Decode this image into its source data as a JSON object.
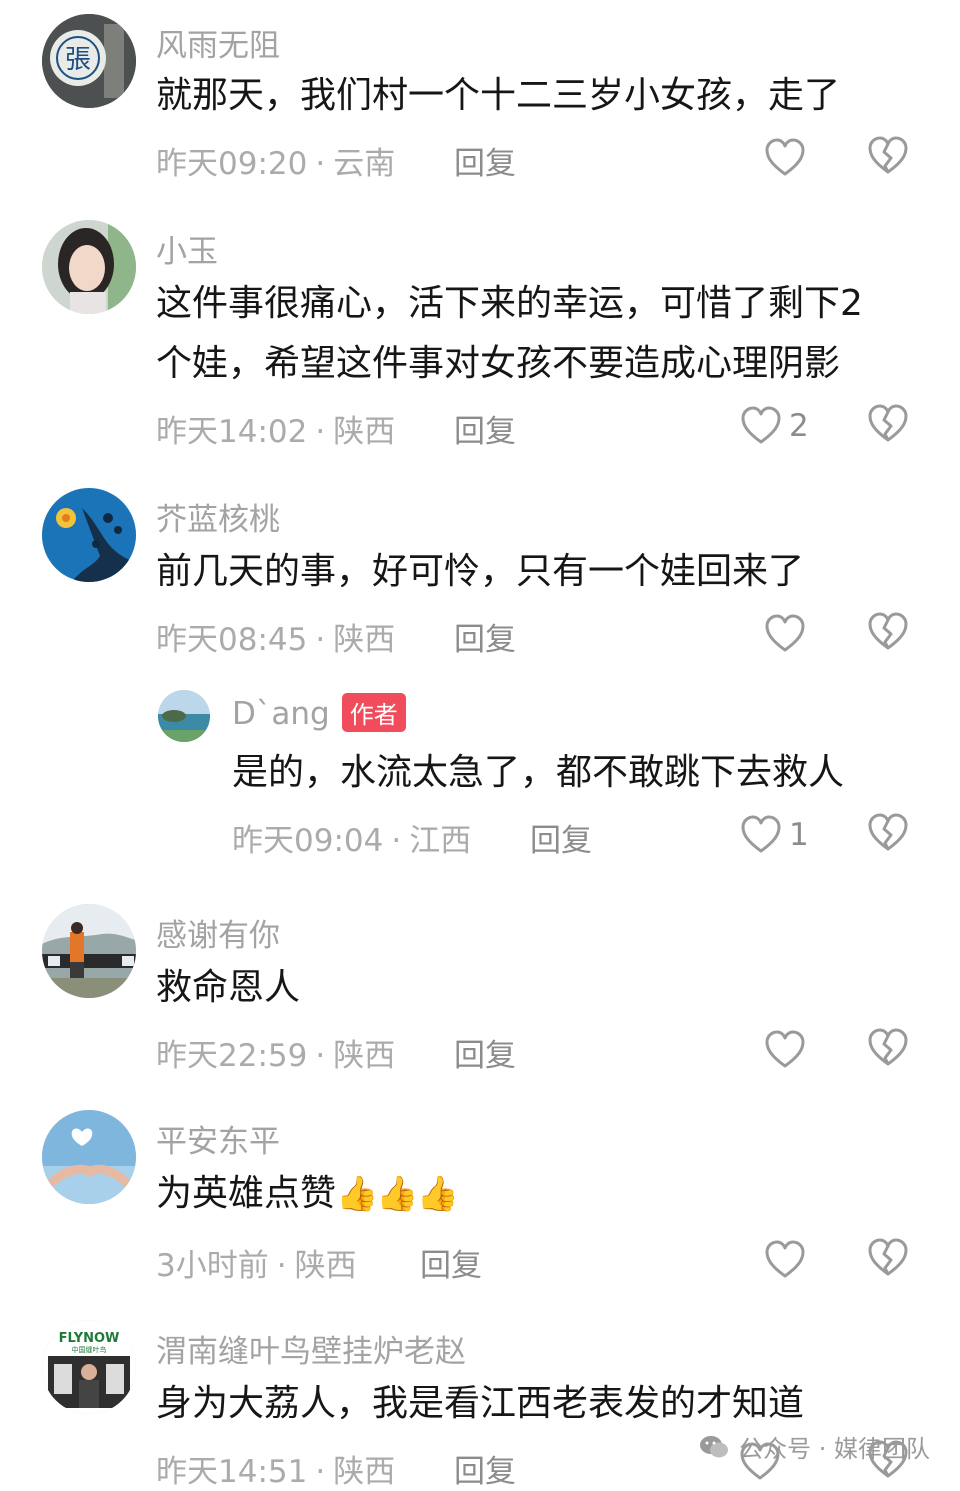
{
  "comments": [
    {
      "user": "风雨无阻",
      "text": "就那天，我们村一个十二三岁小女孩，走了",
      "time": "昨天09:20",
      "location": "云南",
      "reply": "回复",
      "likes": ""
    },
    {
      "user": "小玉",
      "text": "这件事很痛心，活下来的幸运，可惜了剩下2",
      "text2": "个娃，希望这件事对女孩不要造成心理阴影",
      "time": "昨天14:02",
      "location": "陕西",
      "reply": "回复",
      "likes": "2"
    },
    {
      "user": "芥蓝核桃",
      "text": "前几天的事，好可怜，只有一个娃回来了",
      "time": "昨天08:45",
      "location": "陕西",
      "reply": "回复",
      "likes": ""
    },
    {
      "user": "D`ang",
      "tag": "作者",
      "text": "是的，水流太急了，都不敢跳下去救人",
      "time": "昨天09:04",
      "location": "江西",
      "reply": "回复",
      "likes": "1"
    },
    {
      "user": "感谢有你",
      "text": "救命恩人",
      "time": "昨天22:59",
      "location": "陕西",
      "reply": "回复",
      "likes": ""
    },
    {
      "user": "平安东平",
      "text": "为英雄点赞",
      "emoji": "👍👍👍",
      "time": "3小时前",
      "location": "陕西",
      "reply": "回复",
      "likes": ""
    },
    {
      "user": "渭南缝叶鸟壁挂炉老赵",
      "text": "身为大荔人，我是看江西老表发的才知道",
      "time": "昨天14:51",
      "location": "陕西",
      "reply": "回复",
      "likes": ""
    }
  ],
  "avatars": {
    "a1_char": "張",
    "a7_logo": "FLYNOW",
    "a7_sub": "中国缝叶鸟"
  },
  "watermark": {
    "text": "公众号 · 媒律团队"
  },
  "colors": {
    "author_tag": "#f04c5c",
    "username": "#a3a3a3",
    "text": "#161616"
  }
}
